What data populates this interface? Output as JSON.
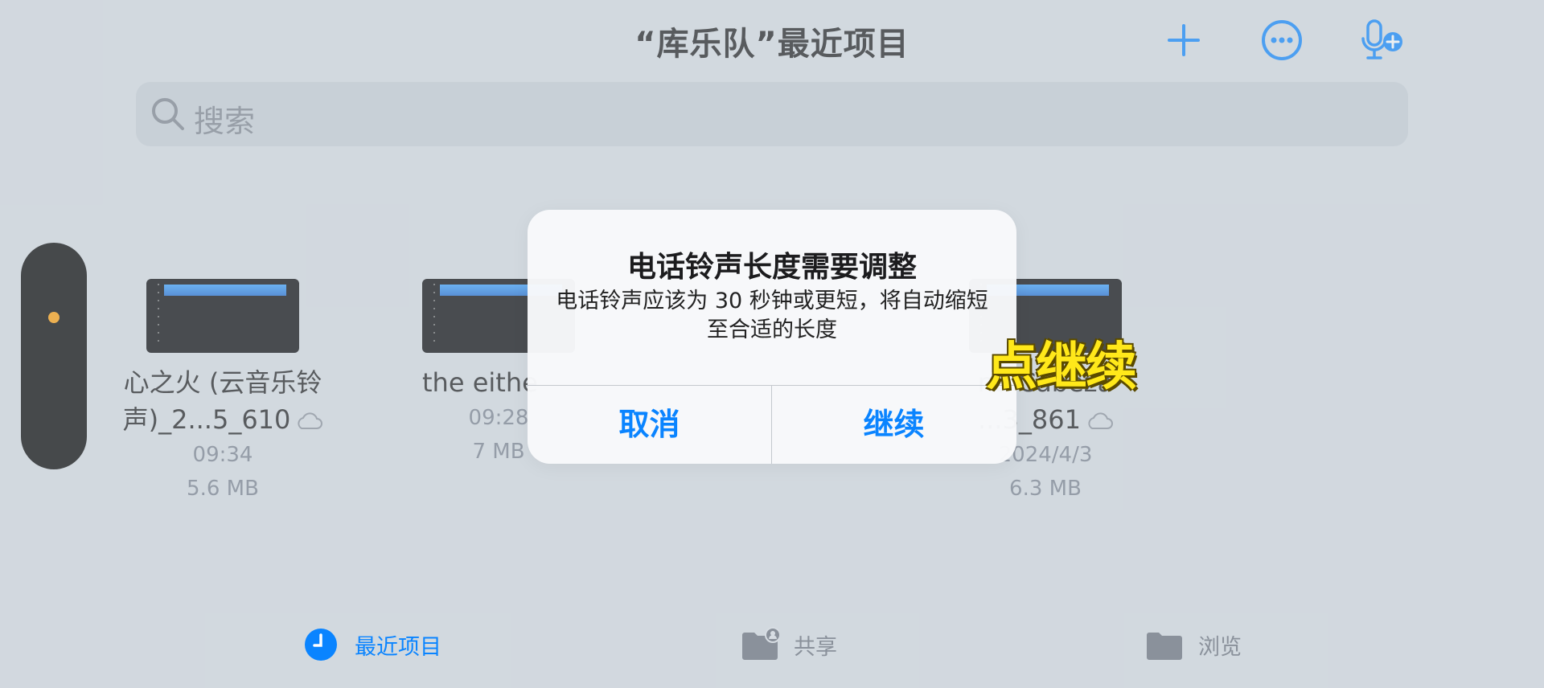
{
  "header": {
    "title": "“库乐队”最近项目",
    "icons": [
      "plus-icon",
      "more-ellipsis-icon",
      "mic-add-icon"
    ]
  },
  "search": {
    "placeholder": "搜索"
  },
  "files": [
    {
      "name_line1": "心之火 (云音乐铃",
      "name_line2": "声)_2...5_610",
      "date": "09:34",
      "size": "5.6 MB"
    },
    {
      "name_line1": "the eithe",
      "name_line2": "",
      "date": "09:28",
      "size": "7 MB"
    },
    {
      "name_line1": "na Cabeza",
      "name_line2": "...3_861",
      "date": "2024/4/3",
      "size": "6.3 MB"
    }
  ],
  "alert": {
    "title": "电话铃声长度需要调整",
    "message": "电话铃声应该为 30 秒钟或更短，将自动缩短至合适的长度",
    "cancel_label": "取消",
    "continue_label": "继续"
  },
  "caption": "点继续",
  "tabs": [
    {
      "label": "最近项目",
      "active": true
    },
    {
      "label": "共享",
      "active": false
    },
    {
      "label": "浏览",
      "active": false
    }
  ],
  "colors": {
    "accent": "#0a84ff",
    "caption": "#ffe81a",
    "indicator": "#ff9f0a"
  }
}
